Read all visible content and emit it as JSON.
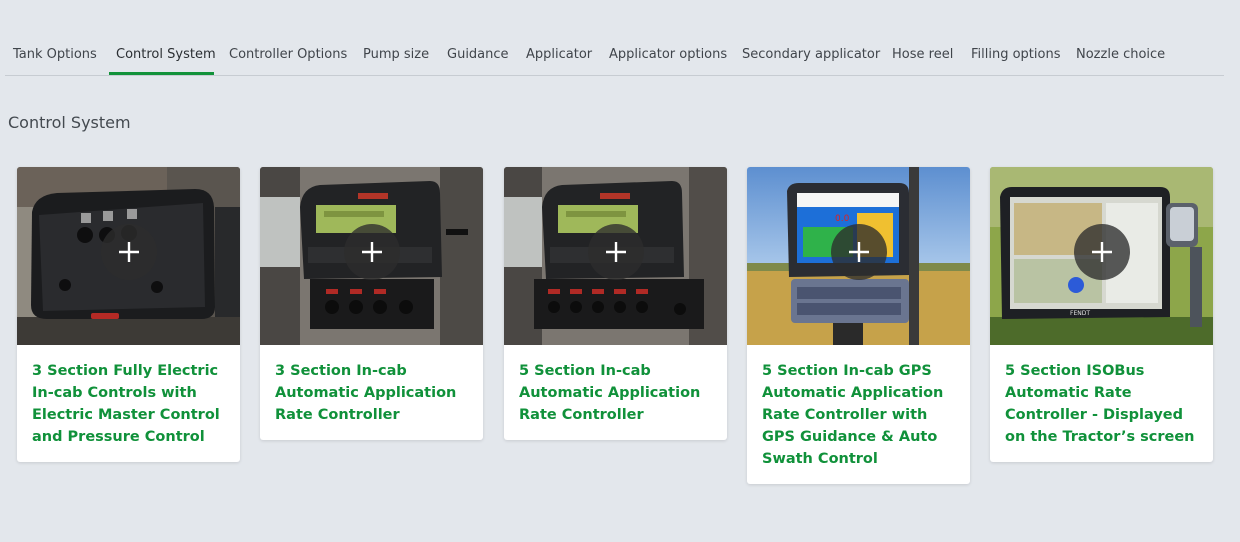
{
  "tabs": [
    {
      "label": "Tank Options"
    },
    {
      "label": "Control System",
      "active": true
    },
    {
      "label": "Controller Options"
    },
    {
      "label": "Pump size"
    },
    {
      "label": "Guidance"
    },
    {
      "label": "Applicator"
    },
    {
      "label": "Applicator options"
    },
    {
      "label": "Secondary applicator"
    },
    {
      "label": "Hose reel"
    },
    {
      "label": "Filling options"
    },
    {
      "label": "Nozzle choice"
    }
  ],
  "section_title": "Control System",
  "cards": [
    {
      "title": "3 Section Fully Electric In-cab Controls with Electric Master Control and Pressure Control",
      "image": "electric-control-box-photo"
    },
    {
      "title": "3 Section In-cab Automatic Application Rate Controller",
      "image": "rate-controller-3-section-photo"
    },
    {
      "title": "5 Section In-cab Automatic Application Rate Controller",
      "image": "rate-controller-5-section-photo"
    },
    {
      "title": "5 Section In-cab GPS Automatic Application Rate Controller with GPS Guidance & Auto Swath Control",
      "image": "gps-display-photo"
    },
    {
      "title": "5 Section ISOBus Automatic Rate Controller - Displayed on the Tractor’s screen",
      "image": "isobus-tractor-screen-photo"
    }
  ],
  "add_icon": "plus-icon",
  "colors": {
    "accent": "#12923a",
    "card_title": "#10913a",
    "background": "#e3e7ec"
  }
}
